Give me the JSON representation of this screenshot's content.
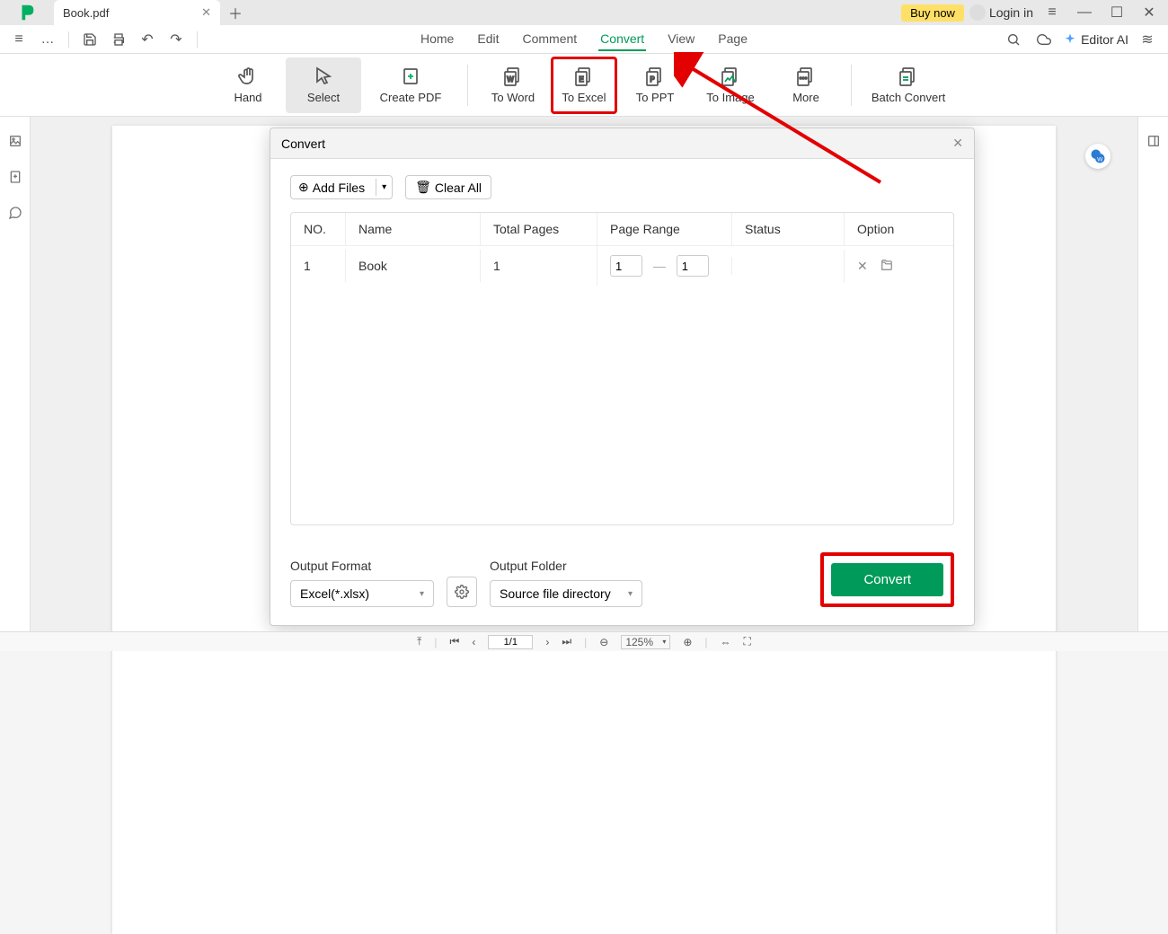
{
  "titlebar": {
    "tab_name": "Book.pdf",
    "buy_label": "Buy now",
    "login_label": "Login in"
  },
  "menu": {
    "items": [
      "Home",
      "Edit",
      "Comment",
      "Convert",
      "View",
      "Page"
    ],
    "active_index": 3,
    "editor_ai": "Editor AI"
  },
  "ribbon": {
    "tools": [
      {
        "label": "Hand"
      },
      {
        "label": "Select"
      },
      {
        "label": "Create PDF"
      },
      {
        "label": "To Word"
      },
      {
        "label": "To Excel"
      },
      {
        "label": "To PPT"
      },
      {
        "label": "To Image"
      },
      {
        "label": "More"
      },
      {
        "label": "Batch Convert"
      }
    ]
  },
  "dialog": {
    "title": "Convert",
    "add_files": "Add Files",
    "clear_all": "Clear All",
    "columns": {
      "no": "NO.",
      "name": "Name",
      "total": "Total Pages",
      "range": "Page Range",
      "status": "Status",
      "option": "Option"
    },
    "rows": [
      {
        "no": "1",
        "name": "Book",
        "total": "1",
        "range_from": "1",
        "range_to": "1",
        "status": ""
      }
    ],
    "output_format_label": "Output Format",
    "output_format_value": "Excel(*.xlsx)",
    "output_folder_label": "Output Folder",
    "output_folder_value": "Source file directory",
    "convert_label": "Convert"
  },
  "statusbar": {
    "page": "1/1",
    "zoom": "125%"
  }
}
